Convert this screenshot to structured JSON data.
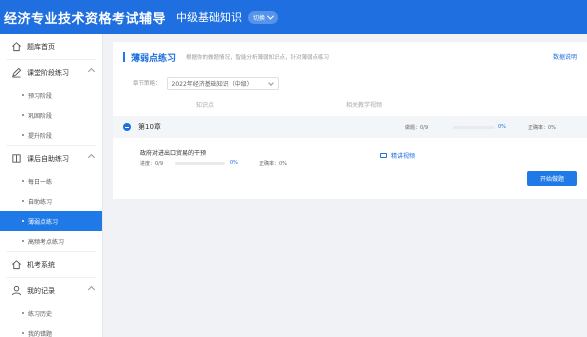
{
  "header": {
    "app_title": "经济专业技术资格考试辅导",
    "subject": "中级基础知识",
    "switch_label": "切换"
  },
  "sidebar": {
    "groups": [
      {
        "label": "题库首页",
        "icon": "home-icon",
        "items": []
      },
      {
        "label": "课堂阶段练习",
        "icon": "pen-icon",
        "items": [
          "预习阶段",
          "巩固阶段",
          "提升阶段"
        ]
      },
      {
        "label": "课后自助练习",
        "icon": "book-icon",
        "items": [
          "每日一练",
          "自助练习",
          "薄弱点练习",
          "高频考点练习"
        ]
      },
      {
        "label": "机考系统",
        "icon": "monitor-icon",
        "items": []
      },
      {
        "label": "我的记录",
        "icon": "user-icon",
        "items": [
          "练习历史",
          "我的错题"
        ]
      }
    ],
    "active_item": "薄弱点练习"
  },
  "main": {
    "title": "薄弱点练习",
    "description": "根据你的做题情况，智能分析薄弱知识点，针对薄弱点练习",
    "data_link": "数据说明",
    "filter_label": "章节策略：",
    "filter_value": "2022年经济基础知识（中级）",
    "col_knowledge": "知识点",
    "col_video": "相关教学视频",
    "chapter": {
      "name": "第10章",
      "done_label": "做题：0/9",
      "progress": 0,
      "progress_text": "0%",
      "accuracy_label": "正确率：0%"
    },
    "knowledge_point": {
      "name": "政府对进出口贸易的干预",
      "done_label": "进度：0/9",
      "progress": 0,
      "progress_text": "0%",
      "accuracy_label": "正确率：0%",
      "video_label": "精讲视频",
      "start_label": "开始做题"
    }
  },
  "colors": {
    "primary": "#1f6fe0",
    "active_bg": "#1f7ae8"
  }
}
